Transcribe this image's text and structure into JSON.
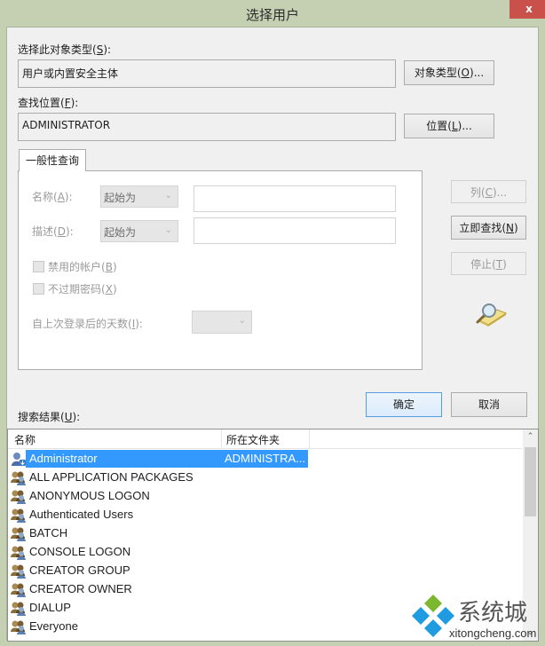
{
  "window": {
    "title": "选择用户",
    "close_label": "x"
  },
  "object_type": {
    "label": "选择此对象类型",
    "accel": "S",
    "value": "用户或内置安全主体",
    "button_label": "对象类型",
    "button_accel": "O",
    "button_suffix": "..."
  },
  "location": {
    "label": "查找位置",
    "accel": "F",
    "value": "ADMINISTRATOR",
    "button_label": "位置",
    "button_accel": "L",
    "button_suffix": "..."
  },
  "tabs": [
    {
      "label": "一般性查询",
      "active": true
    }
  ],
  "query": {
    "name_label": "名称",
    "name_accel": "A",
    "name_mode": "起始为",
    "name_value": "",
    "desc_label": "描述",
    "desc_accel": "D",
    "desc_mode": "起始为",
    "desc_value": "",
    "disabled_accounts_label": "禁用的帐户",
    "disabled_accounts_accel": "B",
    "disabled_accounts_checked": false,
    "no_expire_label": "不过期密码",
    "no_expire_accel": "X",
    "no_expire_checked": false,
    "days_label": "自上次登录后的天数",
    "days_accel": "I",
    "days_value": ""
  },
  "side_buttons": {
    "columns_label": "列",
    "columns_accel": "C",
    "columns_suffix": "...",
    "find_now_label": "立即查找",
    "find_now_accel": "N",
    "stop_label": "停止",
    "stop_accel": "T"
  },
  "dialog_buttons": {
    "ok_label": "确定",
    "cancel_label": "取消"
  },
  "results": {
    "label": "搜索结果",
    "accel": "U",
    "columns": [
      "名称",
      "所在文件夹"
    ],
    "rows": [
      {
        "name": "Administrator",
        "folder": "ADMINISTRA...",
        "icon": "user-icon",
        "selected": true
      },
      {
        "name": "ALL APPLICATION PACKAGES",
        "folder": "",
        "icon": "group-icon",
        "selected": false
      },
      {
        "name": "ANONYMOUS LOGON",
        "folder": "",
        "icon": "group-icon",
        "selected": false
      },
      {
        "name": "Authenticated Users",
        "folder": "",
        "icon": "group-icon",
        "selected": false
      },
      {
        "name": "BATCH",
        "folder": "",
        "icon": "group-icon",
        "selected": false
      },
      {
        "name": "CONSOLE LOGON",
        "folder": "",
        "icon": "group-icon",
        "selected": false
      },
      {
        "name": "CREATOR GROUP",
        "folder": "",
        "icon": "group-icon",
        "selected": false
      },
      {
        "name": "CREATOR OWNER",
        "folder": "",
        "icon": "group-icon",
        "selected": false
      },
      {
        "name": "DIALUP",
        "folder": "",
        "icon": "group-icon",
        "selected": false
      },
      {
        "name": "Everyone",
        "folder": "",
        "icon": "group-icon",
        "selected": false
      }
    ]
  },
  "watermark": {
    "brand": "系统城",
    "url": "xitongcheng.com"
  },
  "colors": {
    "selection": "#3399ff",
    "close_button": "#c9504b",
    "frame": "#c5d0b3"
  }
}
